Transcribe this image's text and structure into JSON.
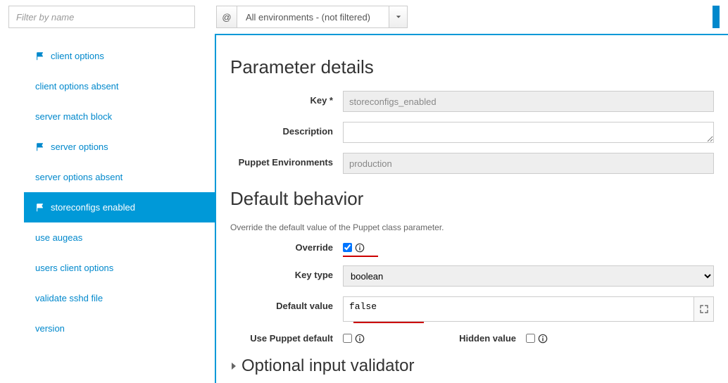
{
  "filter": {
    "placeholder": "Filter by name"
  },
  "env": {
    "at": "@",
    "text": "All environments - (not filtered)"
  },
  "sidebar": {
    "items": [
      {
        "label": "client options",
        "flag": true
      },
      {
        "label": "client options absent",
        "flag": false
      },
      {
        "label": "server match block",
        "flag": false
      },
      {
        "label": "server options",
        "flag": true
      },
      {
        "label": "server options absent",
        "flag": false
      },
      {
        "label": "storeconfigs enabled",
        "flag": true
      },
      {
        "label": "use augeas",
        "flag": false
      },
      {
        "label": "users client options",
        "flag": false
      },
      {
        "label": "validate sshd file",
        "flag": false
      },
      {
        "label": "version",
        "flag": false
      }
    ],
    "selected_index": 5
  },
  "sections": {
    "param": {
      "title": "Parameter details"
    },
    "behavior": {
      "title": "Default behavior",
      "helper": "Override the default value of the Puppet class parameter."
    }
  },
  "labels": {
    "key": "Key *",
    "description": "Description",
    "envs": "Puppet Environments",
    "override": "Override",
    "key_type": "Key type",
    "default_value": "Default value",
    "use_puppet_default": "Use Puppet default",
    "hidden_value": "Hidden value"
  },
  "values": {
    "key": "storeconfigs_enabled",
    "description": "",
    "envs": "production",
    "key_type": "boolean",
    "default_value": "false",
    "override": true,
    "use_puppet_default": false,
    "hidden_value": false
  },
  "collapsible": {
    "label": "Optional input validator"
  }
}
